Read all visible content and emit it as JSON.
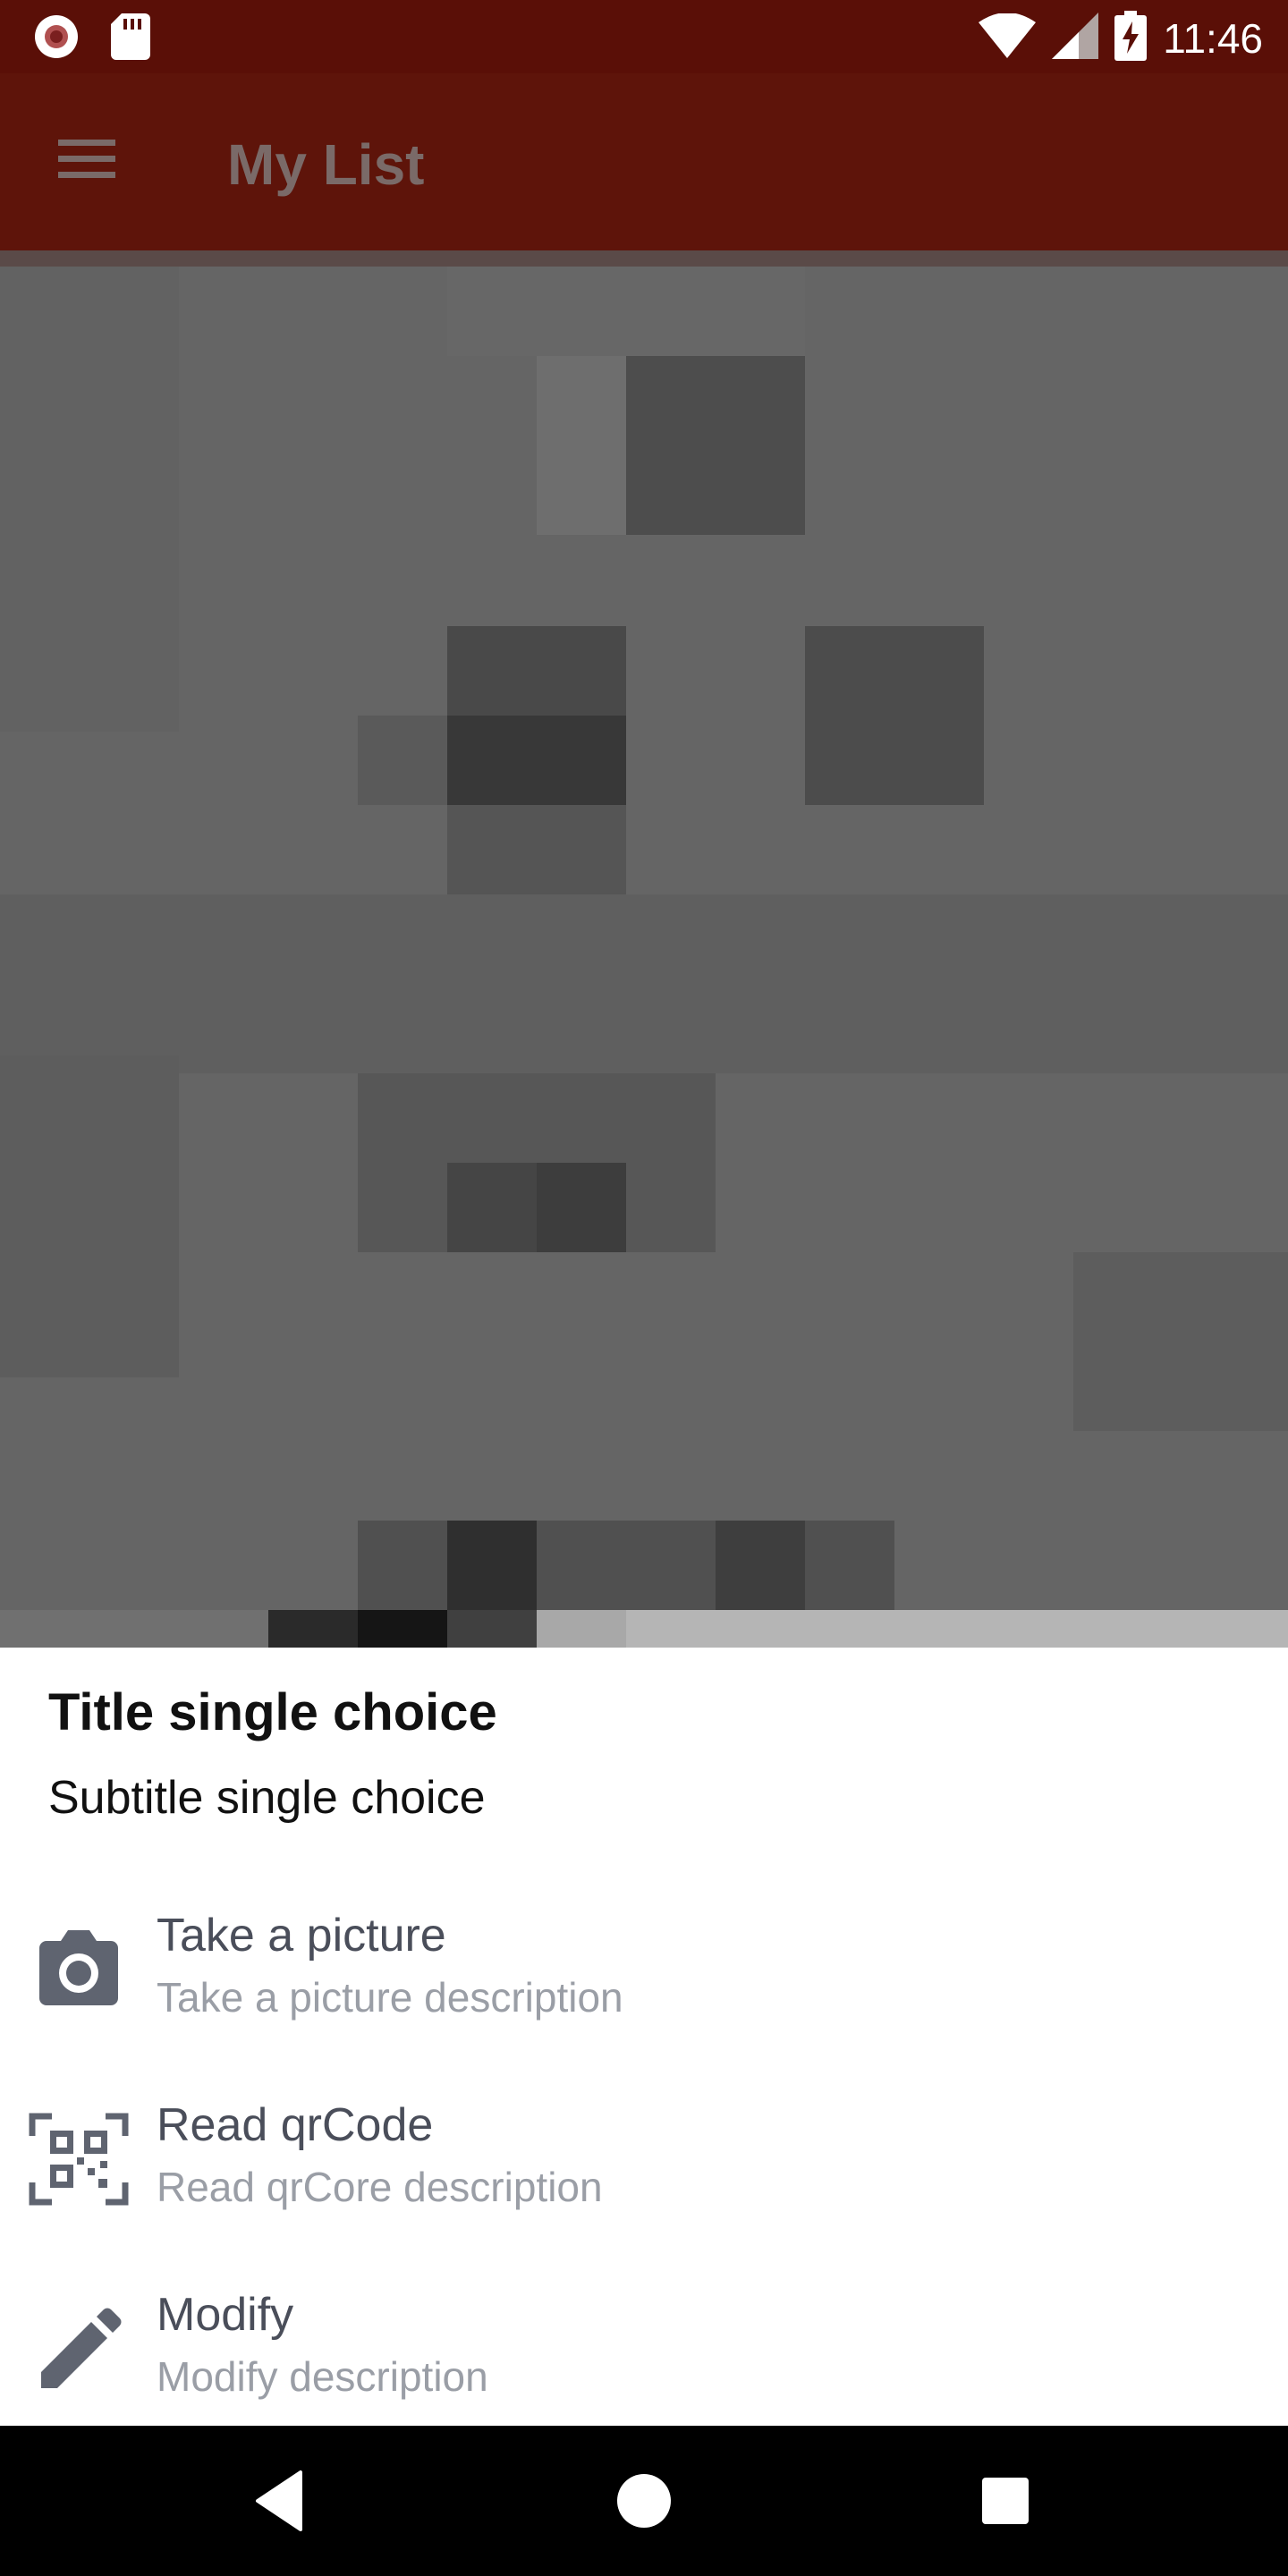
{
  "status_bar": {
    "time": "11:46",
    "left_icons": [
      "record-icon",
      "sd-card-icon"
    ],
    "right_icons": [
      "wifi-icon",
      "cell-signal-icon",
      "battery-charging-icon"
    ]
  },
  "toolbar": {
    "title": "My List",
    "menu_icon": "hamburger-menu-icon"
  },
  "sheet": {
    "title": "Title single choice",
    "subtitle": "Subtitle single choice",
    "items": [
      {
        "icon": "camera-icon",
        "label": "Take a picture",
        "description": "Take a picture description"
      },
      {
        "icon": "qr-code-icon",
        "label": "Read qrCode",
        "description": "Read qrCore description"
      },
      {
        "icon": "pencil-icon",
        "label": "Modify",
        "description": "Modify description"
      }
    ]
  },
  "nav_bar": {
    "icons": [
      "back-icon",
      "home-icon",
      "recents-icon"
    ]
  },
  "colors": {
    "status_bar": "#5a0f07",
    "toolbar": "#5e140a",
    "sheet_background": "#ffffff",
    "item_label": "#4a4e5a",
    "item_description": "#9a9ea6",
    "icon": "#5f6470"
  }
}
